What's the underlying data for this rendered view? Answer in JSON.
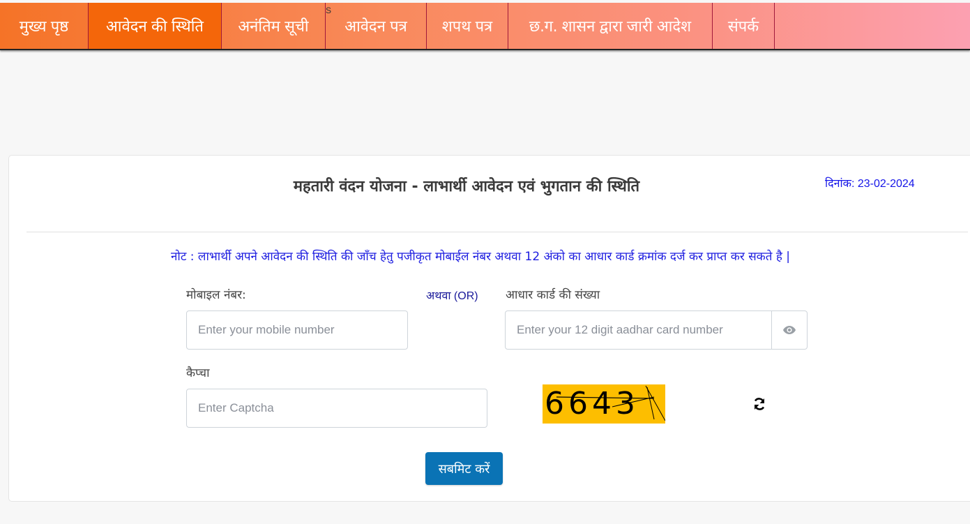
{
  "nav": {
    "items": [
      {
        "label": "मुख्य पृष्ठ",
        "active": false
      },
      {
        "label": "आवेदन की स्थिति",
        "active": true
      },
      {
        "label": "अनंतिम सूची",
        "active": false
      },
      {
        "label": "आवेदन पत्र",
        "active": false,
        "sup": "S"
      },
      {
        "label": "शपथ पत्र",
        "active": false
      },
      {
        "label": "छ.ग. शासन द्वारा जारी आदेश",
        "active": false
      },
      {
        "label": "संपर्क",
        "active": false
      }
    ]
  },
  "page": {
    "title": "महतारी वंदन योजना - लाभार्थी आवेदन एवं भुगतान की स्थिति",
    "date_label": "दिनांक: 23-02-2024",
    "note": "नोट : लाभार्थी अपने आवेदन की स्थिति की जाँच हेतु पजीकृत मोबाईल नंबर अथवा 12 अंको का आधार कार्ड क्रमांक दर्ज कर प्राप्त कर सकते है |"
  },
  "form": {
    "mobile": {
      "label": "मोबाइल नंबर:",
      "placeholder": "Enter your mobile number",
      "value": ""
    },
    "or_label": "अथवा (OR)",
    "aadhar": {
      "label": "आधार कार्ड की संख्या",
      "placeholder": "Enter your 12 digit aadhar card number",
      "value": "",
      "toggle_icon": "eye-icon"
    },
    "captcha": {
      "label": "कैप्चा",
      "placeholder": "Enter Captcha",
      "value": "",
      "image_text": "6643",
      "image_bg": "#fdbe00",
      "refresh_icon": "refresh-icon"
    },
    "submit_label": "सबमिट करें"
  },
  "colors": {
    "nav_active": "#f4660a",
    "title": "#3a3a3a",
    "date": "#1515e8",
    "note": "#1c1ce0",
    "submit": "#0a73b5"
  }
}
